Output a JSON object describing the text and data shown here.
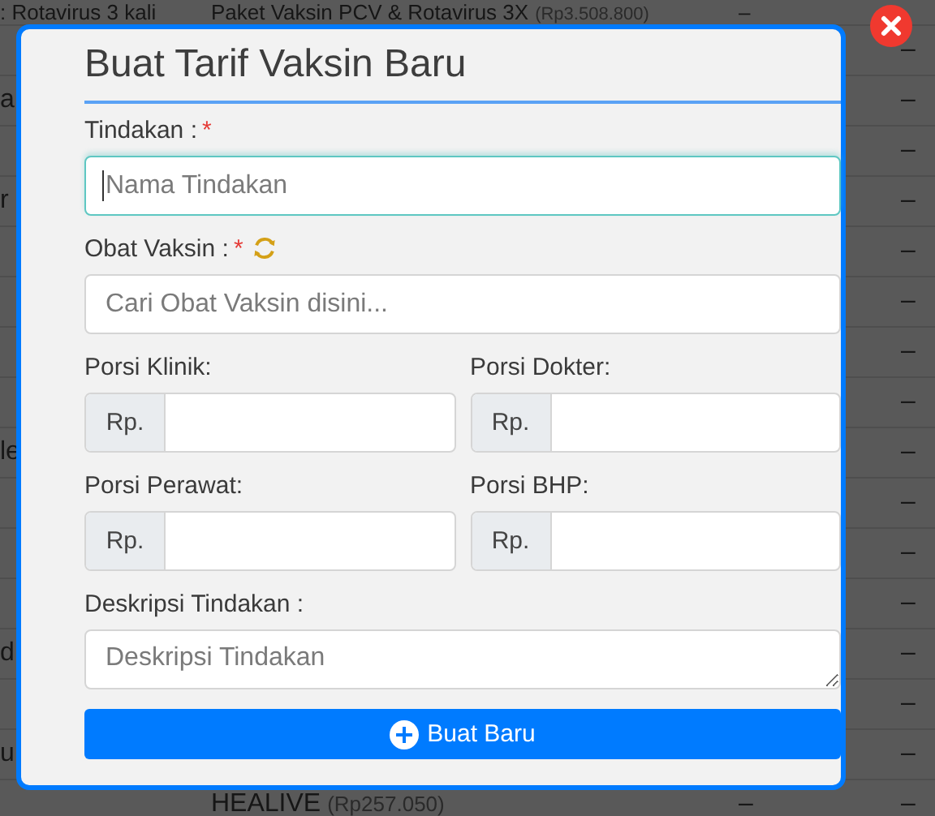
{
  "background_rows": [
    {
      "column_1": ": Rotavirus 3 kali",
      "column_2": "Paket Vaksin PCV & Rotavirus 3X",
      "price": "(Rp3.508.800)",
      "column_3": "–"
    },
    {
      "column_4": "–"
    },
    {
      "column_1": "a",
      "column_4": "–"
    },
    {
      "column_4": "–"
    },
    {
      "column_1": "r",
      "column_4": "–"
    },
    {
      "column_4": "–"
    },
    {
      "column_4": "–"
    },
    {
      "column_4": "–"
    },
    {
      "column_4": "–"
    },
    {
      "column_1": "le",
      "column_4": "–"
    },
    {
      "column_4": "–"
    },
    {
      "column_4": "–"
    },
    {
      "column_4": "–"
    },
    {
      "column_1": "d",
      "column_4": "–"
    },
    {
      "column_4": "–"
    },
    {
      "column_1": "u",
      "column_4": "–"
    },
    {
      "column_2": "HEALIVE",
      "price": "(Rp257.050)",
      "column_3": "–",
      "column_4": "–"
    }
  ],
  "modal": {
    "title": "Buat Tarif Vaksin Baru",
    "fields": [
      {
        "kind": "text",
        "label": "Tindakan :",
        "required_mark": "*",
        "placeholder": "Nama Tindakan",
        "focused": true
      },
      {
        "kind": "search",
        "label": "Obat Vaksin :",
        "required_mark": "*",
        "placeholder": "Cari Obat Vaksin disini...",
        "focused": false
      },
      {
        "kind": "money",
        "label": "Porsi Klinik:",
        "prefix": "Rp.",
        "focused": false
      },
      {
        "kind": "money",
        "label": "Porsi Dokter:",
        "prefix": "Rp.",
        "focused": false
      },
      {
        "kind": "money",
        "label": "Porsi Perawat:",
        "prefix": "Rp.",
        "focused": false
      },
      {
        "kind": "money",
        "label": "Porsi BHP:",
        "prefix": "Rp.",
        "focused": false
      },
      {
        "kind": "textarea",
        "label": "Deskripsi Tindakan :",
        "placeholder": "Deskripsi Tindakan",
        "focused": false
      }
    ],
    "submit": {
      "label": "Buat Baru"
    }
  }
}
